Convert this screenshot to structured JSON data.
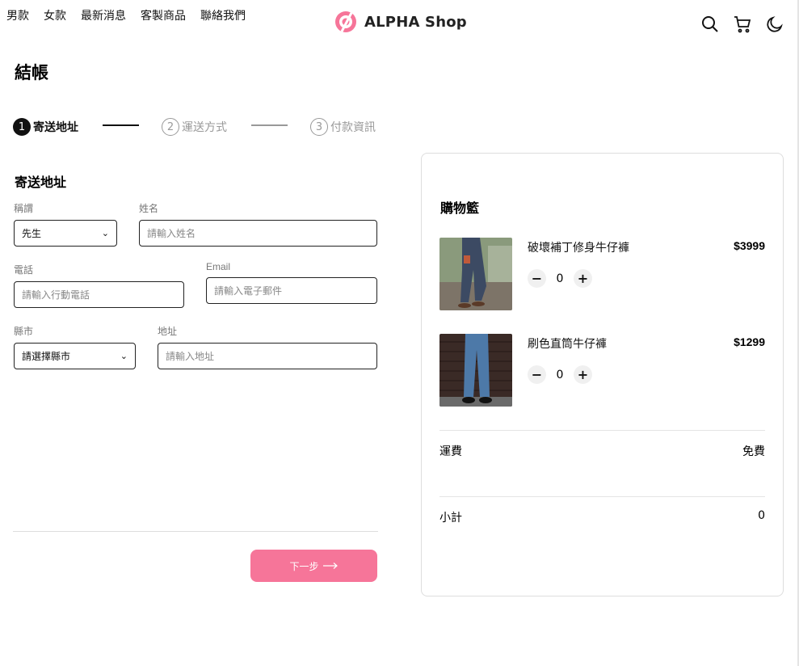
{
  "nav": {
    "items": [
      {
        "label": "男款"
      },
      {
        "label": "女款"
      },
      {
        "label": "最新消息"
      },
      {
        "label": "客製商品"
      },
      {
        "label": "聯絡我們"
      }
    ]
  },
  "brand": {
    "name": "ALPHA Shop",
    "accent": "#f67599"
  },
  "header_icons": [
    "search-icon",
    "cart-icon",
    "moon-icon"
  ],
  "page": {
    "title": "結帳"
  },
  "stepper": {
    "steps": [
      {
        "number": "1",
        "label": "寄送地址",
        "state": "active"
      },
      {
        "number": "2",
        "label": "運送方式",
        "state": "inactive"
      },
      {
        "number": "3",
        "label": "付款資訊",
        "state": "inactive"
      }
    ]
  },
  "form": {
    "section_title": "寄送地址",
    "title_field": {
      "label": "稱謂",
      "value": "先生"
    },
    "name_field": {
      "label": "姓名",
      "placeholder": "請輸入姓名"
    },
    "phone_field": {
      "label": "電話",
      "placeholder": "請輸入行動電話"
    },
    "email_field": {
      "label": "Email",
      "placeholder": "請輸入電子郵件"
    },
    "city_field": {
      "label": "縣市",
      "value": "請選擇縣市"
    },
    "address_field": {
      "label": "地址",
      "placeholder": "請輸入地址"
    }
  },
  "next_button": {
    "label": "下一步"
  },
  "cart": {
    "title": "購物籃",
    "items": [
      {
        "name": "破壞補丁修身牛仔褲",
        "price": "$3999",
        "quantity": "0"
      },
      {
        "name": "刷色直筒牛仔褲",
        "price": "$1299",
        "quantity": "0"
      }
    ],
    "shipping": {
      "label": "運費",
      "value": "免費"
    },
    "subtotal": {
      "label": "小計",
      "value": "0"
    }
  }
}
